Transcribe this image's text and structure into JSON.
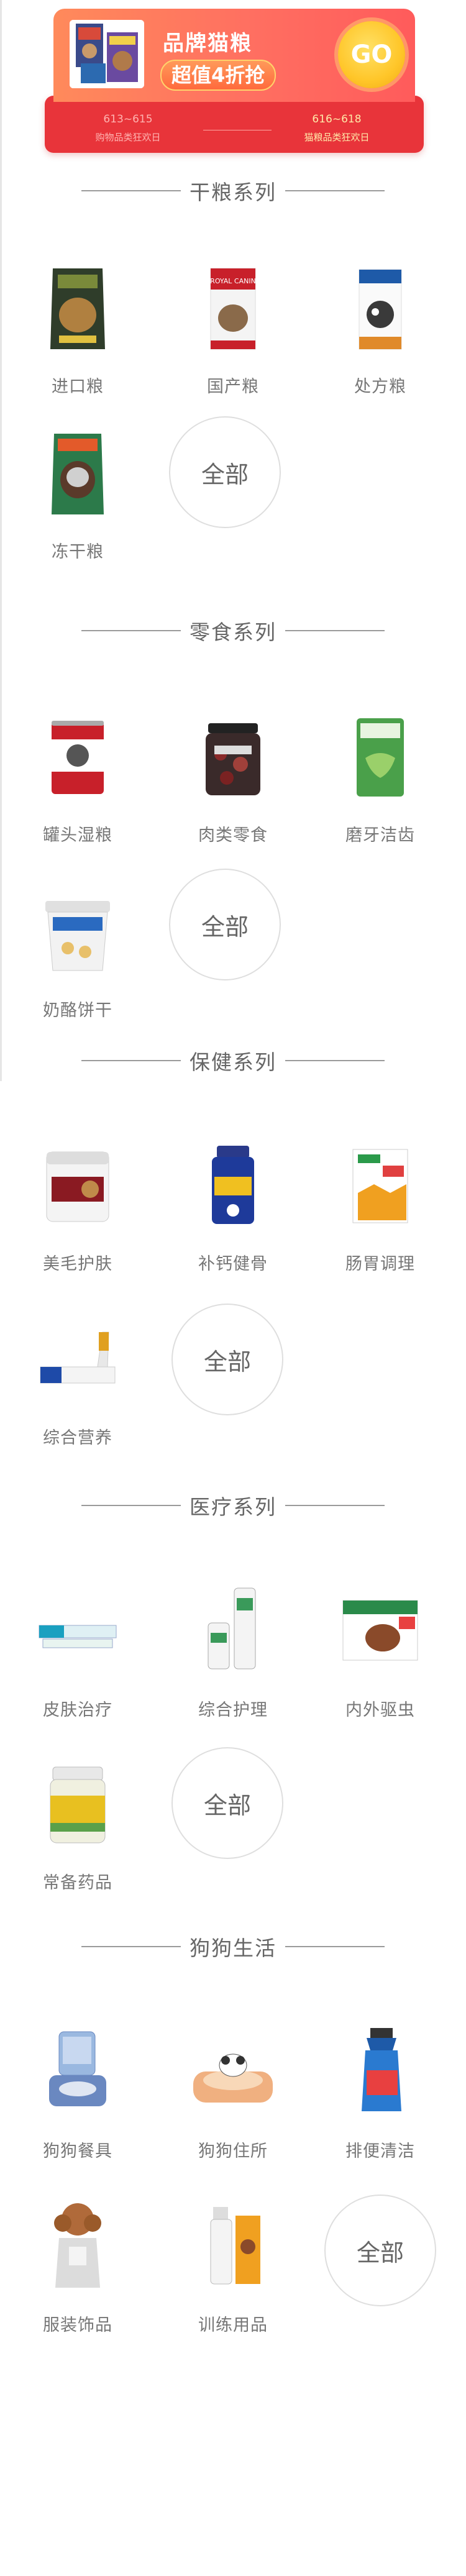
{
  "banner": {
    "title": "品牌猫粮",
    "promo": "超值4折抢",
    "go_label": "GO",
    "left_dates": "613~615",
    "left_caption": "购物品类狂欢日",
    "right_dates": "616~618",
    "right_caption": "猫粮品类狂欢日"
  },
  "sections": [
    {
      "title": "干粮系列",
      "items": [
        "进口粮",
        "国产粮",
        "处方粮",
        "冻干粮"
      ],
      "all_label": "全部"
    },
    {
      "title": "零食系列",
      "items": [
        "罐头湿粮",
        "肉类零食",
        "磨牙洁齿",
        "奶酪饼干"
      ],
      "all_label": "全部"
    },
    {
      "title": "保健系列",
      "items": [
        "美毛护肤",
        "补钙健骨",
        "肠胃调理",
        "综合营养"
      ],
      "all_label": "全部"
    },
    {
      "title": "医疗系列",
      "items": [
        "皮肤治疗",
        "综合护理",
        "内外驱虫",
        "常备药品"
      ],
      "all_label": "全部"
    },
    {
      "title": "狗狗生活",
      "items": [
        "狗狗餐具",
        "狗狗住所",
        "排便清洁",
        "服装饰品",
        "训练用品"
      ],
      "all_label": "全部"
    }
  ],
  "colors": {
    "banner_orange": "#ff6f61",
    "banner_red": "#e8343a",
    "go_yellow": "#ffc629",
    "text_gray": "#666666"
  }
}
